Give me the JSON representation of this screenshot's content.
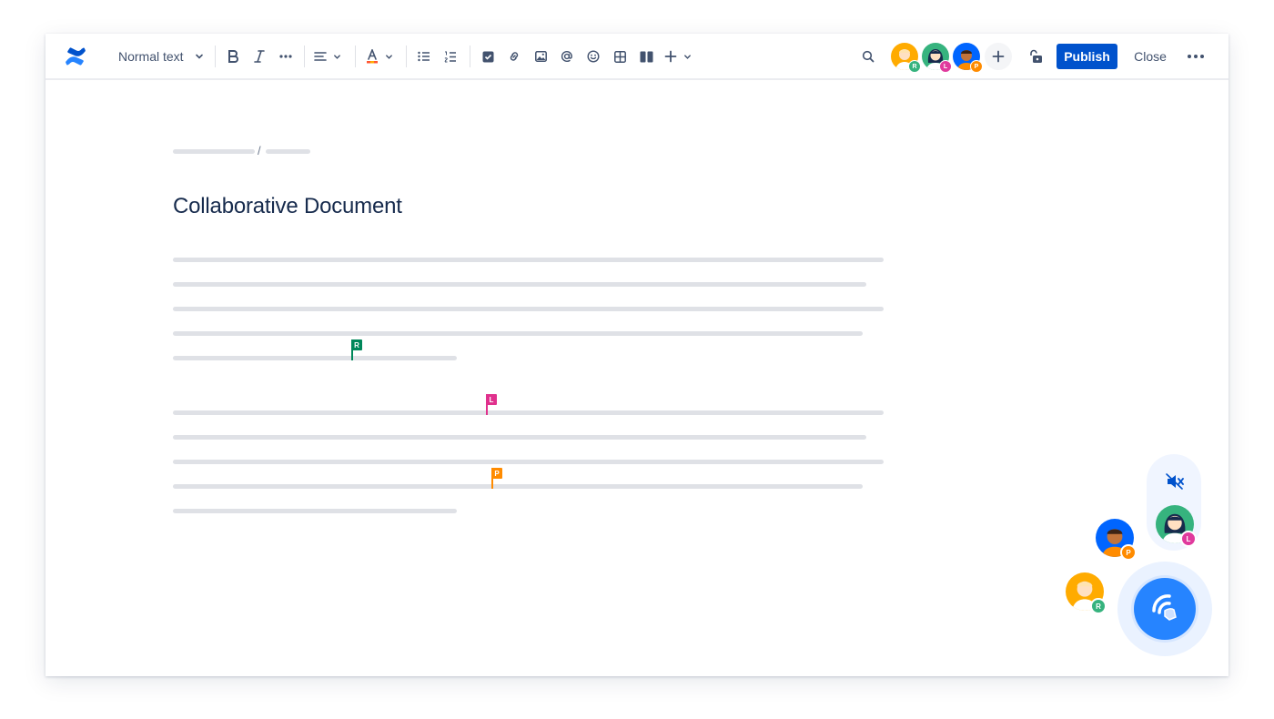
{
  "toolbar": {
    "text_style": "Normal text",
    "publish_label": "Publish",
    "close_label": "Close",
    "collaborators": [
      {
        "initial": "R",
        "badge_color": "#36b37e",
        "bg": "#ffab00"
      },
      {
        "initial": "L",
        "badge_color": "#e03a9d",
        "bg": "#36b37e"
      },
      {
        "initial": "P",
        "badge_color": "#ff8b00",
        "bg": "#0065ff"
      }
    ],
    "icons": [
      "confluence-logo-icon",
      "chevron-down-icon",
      "bold-icon",
      "italic-icon",
      "more-formatting-icon",
      "align-icon",
      "text-color-icon",
      "bullet-list-icon",
      "numbered-list-icon",
      "action-item-icon",
      "link-icon",
      "image-icon",
      "mention-icon",
      "emoji-icon",
      "table-icon",
      "layout-icon",
      "insert-plus-icon",
      "search-icon",
      "add-collaborator-icon",
      "restrictions-unlock-icon",
      "more-icon"
    ]
  },
  "document": {
    "breadcrumb_separator": "/",
    "title": "Collaborative Document"
  },
  "cursors": [
    {
      "initial": "R",
      "color": "#00875a"
    },
    {
      "initial": "L",
      "color": "#e0318d"
    },
    {
      "initial": "P",
      "color": "#ff8b00"
    }
  ],
  "huddle": {
    "participants": [
      {
        "initial": "L",
        "badge_color": "#e03a9d",
        "bg": "#36b37e"
      },
      {
        "initial": "P",
        "badge_color": "#ff8b00",
        "bg": "#0065ff"
      },
      {
        "initial": "R",
        "badge_color": "#36b37e",
        "bg": "#ffab00"
      }
    ],
    "icons": [
      "mute-icon",
      "huddle-icon"
    ],
    "accent": "#2684ff"
  }
}
